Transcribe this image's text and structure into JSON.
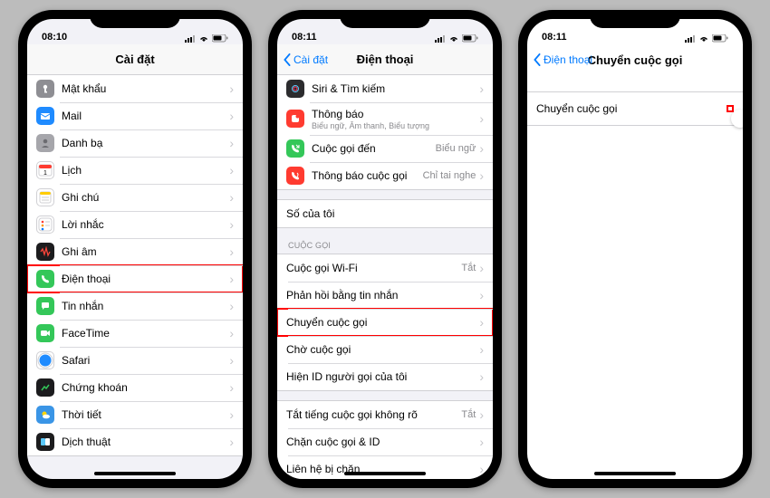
{
  "status": {
    "time1": "08:10",
    "time2": "08:11",
    "time3": "08:11"
  },
  "screen1": {
    "title": "Cài đặt",
    "rows": [
      {
        "label": "Mật khẩu",
        "iconColor": "#8e8e93",
        "glyph": "key"
      },
      {
        "label": "Mail",
        "iconColor": "#1f8bff",
        "glyph": "mail"
      },
      {
        "label": "Danh bạ",
        "iconColor": "#a6a6ab",
        "glyph": "contacts"
      },
      {
        "label": "Lịch",
        "iconColor": "#ffffff",
        "glyph": "calendar"
      },
      {
        "label": "Ghi chú",
        "iconColor": "#ffffff",
        "glyph": "notes"
      },
      {
        "label": "Lời nhắc",
        "iconColor": "#ffffff",
        "glyph": "reminders"
      },
      {
        "label": "Ghi âm",
        "iconColor": "#1c1c1e",
        "glyph": "voice"
      },
      {
        "label": "Điện thoại",
        "iconColor": "#34c759",
        "glyph": "phone",
        "highlight": true
      },
      {
        "label": "Tin nhắn",
        "iconColor": "#34c759",
        "glyph": "message"
      },
      {
        "label": "FaceTime",
        "iconColor": "#34c759",
        "glyph": "facetime"
      },
      {
        "label": "Safari",
        "iconColor": "#ffffff",
        "glyph": "safari"
      },
      {
        "label": "Chứng khoán",
        "iconColor": "#1c1c1e",
        "glyph": "stocks"
      },
      {
        "label": "Thời tiết",
        "iconColor": "#3a95e6",
        "glyph": "weather"
      },
      {
        "label": "Dịch thuật",
        "iconColor": "#1c1c1e",
        "glyph": "translate"
      }
    ]
  },
  "screen2": {
    "back": "Cài đặt",
    "title": "Điện thoại",
    "topRows": [
      {
        "label": "Siri & Tìm kiếm",
        "iconColor": "#2c2c2e",
        "glyph": "siri"
      },
      {
        "label": "Thông báo",
        "sub": "Biểu ngữ, Âm thanh, Biểu tượng",
        "iconColor": "#ff3b30",
        "glyph": "bell"
      },
      {
        "label": "Cuộc gọi đến",
        "value": "Biểu ngữ",
        "iconColor": "#34c759",
        "glyph": "phone-in"
      },
      {
        "label": "Thông báo cuộc gọi",
        "value": "Chỉ tai nghe",
        "iconColor": "#ff3b30",
        "glyph": "announce"
      }
    ],
    "myNumber": {
      "label": "Số của tôi",
      "value": ""
    },
    "callsHeader": "CUỘC GỌI",
    "callRows": [
      {
        "label": "Cuộc gọi Wi-Fi",
        "value": "Tắt"
      },
      {
        "label": "Phản hồi bằng tin nhắn"
      },
      {
        "label": "Chuyển cuộc gọi",
        "highlight": true
      },
      {
        "label": "Chờ cuộc gọi"
      },
      {
        "label": "Hiện ID người gọi của tôi"
      }
    ],
    "bottomRows": [
      {
        "label": "Tắt tiếng cuộc gọi không rõ",
        "value": "Tắt"
      },
      {
        "label": "Chặn cuộc gọi & ID"
      },
      {
        "label": "Liên hệ bị chặn"
      }
    ]
  },
  "screen3": {
    "back": "Điện thoại",
    "title": "Chuyển cuộc gọi",
    "toggleLabel": "Chuyển cuộc gọi",
    "toggleOn": false
  }
}
